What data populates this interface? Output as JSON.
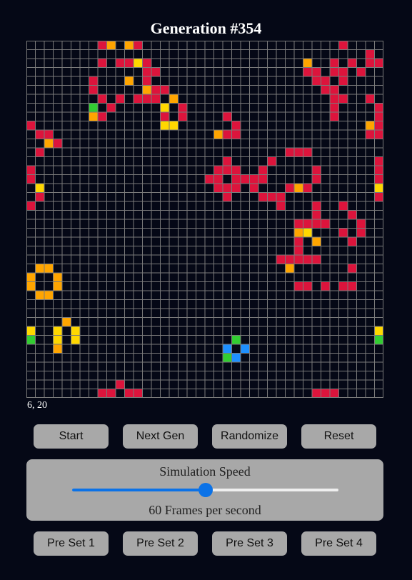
{
  "title": "Generation #354",
  "cursor_readout": "6, 20",
  "controls": {
    "start_label": "Start",
    "next_label": "Next Gen",
    "randomize_label": "Randomize",
    "reset_label": "Reset"
  },
  "speed": {
    "title": "Simulation Speed",
    "readout": "60 Frames per second",
    "value_fraction": 0.5
  },
  "presets": {
    "preset1_label": "Pre Set 1",
    "preset2_label": "Pre Set 2",
    "preset3_label": "Pre Set 3",
    "preset4_label": "Pre Set 4"
  },
  "colors": {
    "background": "#050816",
    "grid_line": "#7a7a7a",
    "red": "#dc143c",
    "orange": "#ffa500",
    "yellow": "#ffd700",
    "green": "#32cd32",
    "blue": "#1e90ff",
    "accent": "#0b72e7"
  },
  "board": {
    "size": 40,
    "cells": {
      "red": [
        [
          8,
          0
        ],
        [
          12,
          0
        ],
        [
          35,
          0
        ],
        [
          38,
          1
        ],
        [
          8,
          2
        ],
        [
          10,
          2
        ],
        [
          11,
          2
        ],
        [
          13,
          2
        ],
        [
          31,
          2
        ],
        [
          34,
          2
        ],
        [
          36,
          2
        ],
        [
          38,
          2
        ],
        [
          39,
          2
        ],
        [
          13,
          3
        ],
        [
          14,
          3
        ],
        [
          31,
          3
        ],
        [
          32,
          3
        ],
        [
          34,
          3
        ],
        [
          35,
          3
        ],
        [
          37,
          3
        ],
        [
          7,
          4
        ],
        [
          13,
          4
        ],
        [
          32,
          4
        ],
        [
          33,
          4
        ],
        [
          35,
          4
        ],
        [
          7,
          5
        ],
        [
          14,
          5
        ],
        [
          15,
          5
        ],
        [
          33,
          5
        ],
        [
          34,
          5
        ],
        [
          8,
          6
        ],
        [
          10,
          6
        ],
        [
          12,
          6
        ],
        [
          13,
          6
        ],
        [
          14,
          6
        ],
        [
          16,
          6
        ],
        [
          34,
          6
        ],
        [
          35,
          6
        ],
        [
          38,
          6
        ],
        [
          9,
          7
        ],
        [
          15,
          7
        ],
        [
          17,
          7
        ],
        [
          34,
          7
        ],
        [
          39,
          7
        ],
        [
          8,
          8
        ],
        [
          15,
          8
        ],
        [
          17,
          8
        ],
        [
          22,
          8
        ],
        [
          34,
          8
        ],
        [
          39,
          8
        ],
        [
          0,
          9
        ],
        [
          23,
          9
        ],
        [
          39,
          9
        ],
        [
          1,
          10
        ],
        [
          2,
          10
        ],
        [
          22,
          10
        ],
        [
          23,
          10
        ],
        [
          38,
          10
        ],
        [
          39,
          10
        ],
        [
          3,
          11
        ],
        [
          1,
          12
        ],
        [
          29,
          12
        ],
        [
          30,
          12
        ],
        [
          31,
          12
        ],
        [
          22,
          13
        ],
        [
          27,
          13
        ],
        [
          39,
          13
        ],
        [
          0,
          14
        ],
        [
          21,
          14
        ],
        [
          22,
          14
        ],
        [
          23,
          14
        ],
        [
          26,
          14
        ],
        [
          32,
          14
        ],
        [
          39,
          14
        ],
        [
          0,
          15
        ],
        [
          20,
          15
        ],
        [
          21,
          15
        ],
        [
          23,
          15
        ],
        [
          24,
          15
        ],
        [
          25,
          15
        ],
        [
          26,
          15
        ],
        [
          32,
          15
        ],
        [
          39,
          15
        ],
        [
          21,
          16
        ],
        [
          22,
          16
        ],
        [
          23,
          16
        ],
        [
          25,
          16
        ],
        [
          29,
          16
        ],
        [
          31,
          16
        ],
        [
          1,
          17
        ],
        [
          22,
          17
        ],
        [
          26,
          17
        ],
        [
          27,
          17
        ],
        [
          28,
          17
        ],
        [
          39,
          17
        ],
        [
          0,
          18
        ],
        [
          28,
          18
        ],
        [
          32,
          18
        ],
        [
          35,
          18
        ],
        [
          32,
          19
        ],
        [
          36,
          19
        ],
        [
          30,
          20
        ],
        [
          31,
          20
        ],
        [
          32,
          20
        ],
        [
          33,
          20
        ],
        [
          37,
          20
        ],
        [
          35,
          21
        ],
        [
          37,
          21
        ],
        [
          30,
          22
        ],
        [
          36,
          22
        ],
        [
          30,
          23
        ],
        [
          28,
          24
        ],
        [
          29,
          24
        ],
        [
          30,
          24
        ],
        [
          31,
          24
        ],
        [
          32,
          24
        ],
        [
          36,
          25
        ],
        [
          30,
          27
        ],
        [
          31,
          27
        ],
        [
          33,
          27
        ],
        [
          35,
          27
        ],
        [
          36,
          27
        ],
        [
          10,
          38
        ],
        [
          8,
          39
        ],
        [
          9,
          39
        ],
        [
          11,
          39
        ],
        [
          12,
          39
        ],
        [
          32,
          39
        ],
        [
          33,
          39
        ],
        [
          34,
          39
        ]
      ],
      "orange": [
        [
          9,
          0
        ],
        [
          11,
          0
        ],
        [
          31,
          2
        ],
        [
          11,
          4
        ],
        [
          13,
          5
        ],
        [
          16,
          6
        ],
        [
          7,
          8
        ],
        [
          21,
          10
        ],
        [
          38,
          9
        ],
        [
          2,
          11
        ],
        [
          30,
          16
        ],
        [
          30,
          21
        ],
        [
          32,
          22
        ],
        [
          29,
          25
        ],
        [
          1,
          25
        ],
        [
          2,
          25
        ],
        [
          0,
          26
        ],
        [
          3,
          26
        ],
        [
          0,
          27
        ],
        [
          3,
          27
        ],
        [
          1,
          28
        ],
        [
          2,
          28
        ],
        [
          4,
          31
        ],
        [
          3,
          34
        ]
      ],
      "yellow": [
        [
          12,
          2
        ],
        [
          15,
          7
        ],
        [
          15,
          9
        ],
        [
          16,
          9
        ],
        [
          1,
          16
        ],
        [
          39,
          16
        ],
        [
          31,
          21
        ],
        [
          0,
          32
        ],
        [
          3,
          32
        ],
        [
          5,
          32
        ],
        [
          3,
          33
        ],
        [
          5,
          33
        ],
        [
          39,
          32
        ]
      ],
      "green": [
        [
          7,
          7
        ],
        [
          0,
          33
        ],
        [
          39,
          33
        ],
        [
          23,
          33
        ],
        [
          22,
          35
        ]
      ],
      "blue": [
        [
          22,
          34
        ],
        [
          24,
          34
        ],
        [
          23,
          35
        ]
      ]
    }
  }
}
